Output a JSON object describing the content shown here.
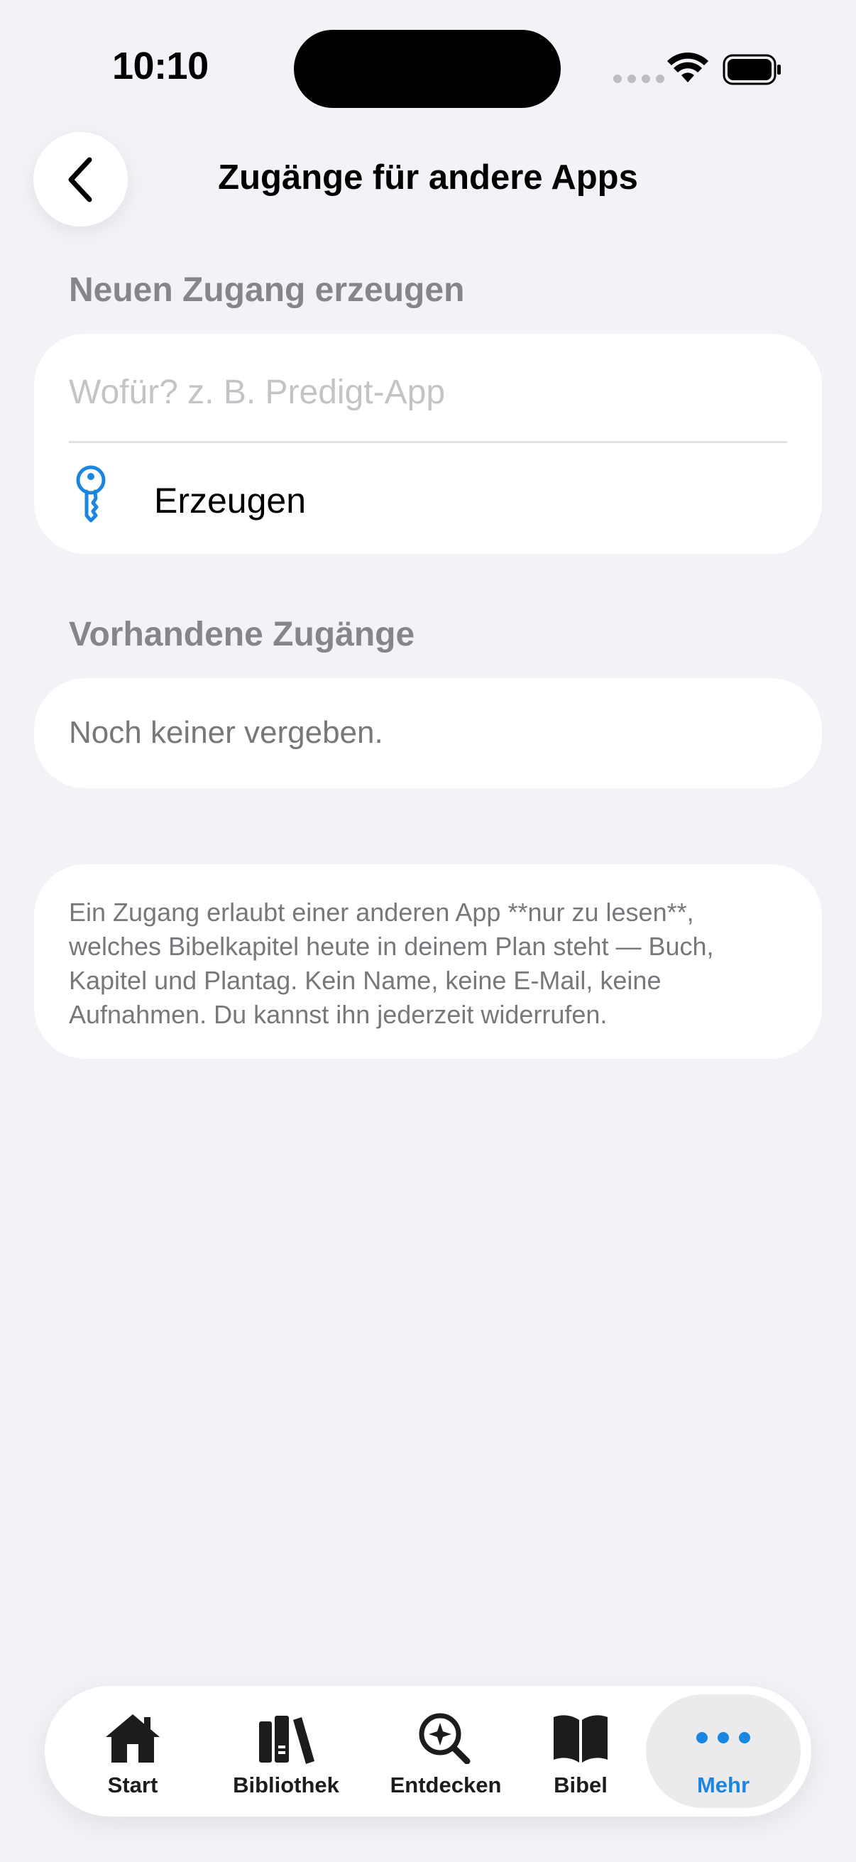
{
  "status_bar": {
    "time": "10:10"
  },
  "nav": {
    "title": "Zugänge für andere Apps"
  },
  "new_access": {
    "header": "Neuen Zugang erzeugen",
    "placeholder": "Wofür? z. B. Predigt-App",
    "value": "",
    "create_label": "Erzeugen"
  },
  "existing": {
    "header": "Vorhandene Zugänge",
    "empty_text": "Noch keiner vergeben."
  },
  "info": {
    "text": "Ein Zugang erlaubt einer anderen App **nur zu lesen**, welches Bibelkapitel heute in deinem Plan steht — Buch, Kapitel und Plantag. Kein Name, keine E-Mail, keine Aufnahmen. Du kannst ihn jederzeit widerrufen."
  },
  "tabbar": {
    "items": [
      {
        "label": "Start",
        "icon": "house-icon"
      },
      {
        "label": "Bibliothek",
        "icon": "books-icon"
      },
      {
        "label": "Entdecken",
        "icon": "discover-icon"
      },
      {
        "label": "Bibel",
        "icon": "book-open-icon"
      },
      {
        "label": "Mehr",
        "icon": "ellipsis-icon",
        "selected": true
      }
    ]
  },
  "colors": {
    "accent": "#1A86E0",
    "background": "#F2F2F7",
    "card": "#FFFFFF",
    "secondary_text": "#85858A"
  }
}
